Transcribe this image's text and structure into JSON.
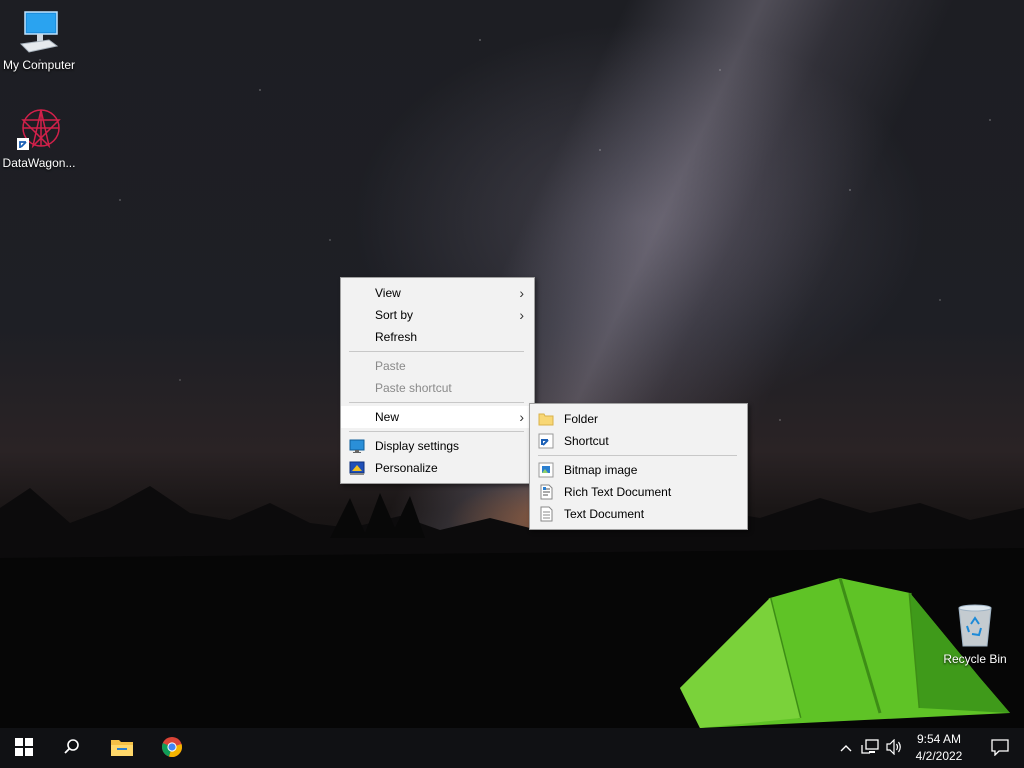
{
  "desktop": {
    "icons": [
      {
        "label": "My Computer",
        "icon": "monitor-icon"
      },
      {
        "label": "DataWagon...",
        "icon": "datawagon-logo-icon"
      },
      {
        "label": "Recycle Bin",
        "icon": "recycle-bin-icon"
      }
    ]
  },
  "context_menu": {
    "items": {
      "view": "View",
      "sort_by": "Sort by",
      "refresh": "Refresh",
      "paste": "Paste",
      "paste_shortcut": "Paste shortcut",
      "new": "New",
      "display_settings": "Display settings",
      "personalize": "Personalize"
    }
  },
  "new_submenu": {
    "items": {
      "folder": "Folder",
      "shortcut": "Shortcut",
      "bitmap": "Bitmap image",
      "rtf": "Rich Text Document",
      "text": "Text Document"
    }
  },
  "taskbar": {
    "clock_time": "9:54 AM",
    "clock_date": "4/2/2022",
    "pinned": [
      "windows-start-icon",
      "search-icon",
      "file-explorer-icon",
      "chrome-icon"
    ],
    "tray": [
      "chevron-up-icon",
      "network-icon",
      "volume-icon",
      "notification-icon"
    ]
  }
}
